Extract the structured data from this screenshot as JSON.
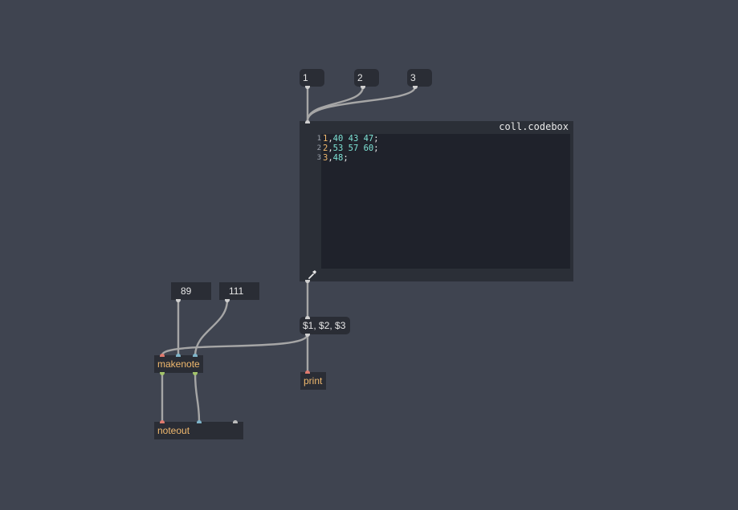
{
  "patcher": {
    "background": "#3f4450",
    "cord_color": "#a6a6a6",
    "object_text_color": "#f1b96e",
    "message_text_color": "#e6e6e6"
  },
  "messages": {
    "msg1": "1",
    "msg2": "2",
    "msg3": "3",
    "list_format": "$1, $2, $3"
  },
  "numbers": {
    "velocity": "89",
    "duration": "111"
  },
  "objects": {
    "makenote": "makenote",
    "noteout": "noteout",
    "print": "print"
  },
  "codebox": {
    "title": "coll.codebox",
    "lines": [
      {
        "number": "1",
        "key": "1",
        "sep": ",",
        "values": "40 43 47",
        "end": ";"
      },
      {
        "number": "2",
        "key": "2",
        "sep": ",",
        "values": "53 57 60",
        "end": ";"
      },
      {
        "number": "3",
        "key": "3",
        "sep": ",",
        "values": "48",
        "end": ";"
      }
    ],
    "icon": "wrench-icon"
  }
}
